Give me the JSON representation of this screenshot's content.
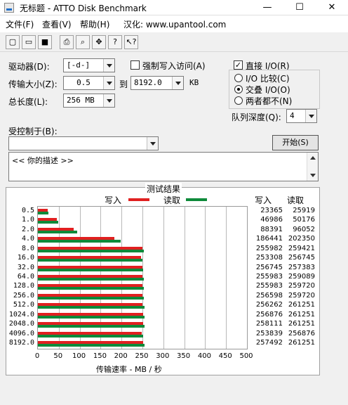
{
  "window": {
    "title": "无标题 - ATTO Disk Benchmark",
    "minimize": "—",
    "maximize": "☐",
    "close": "✕"
  },
  "menu": [
    "文件(F)",
    "查看(V)",
    "帮助(H)",
    "汉化: www.upantool.com"
  ],
  "toolbar": [
    {
      "icon": "new-icon",
      "glyph": "▢"
    },
    {
      "icon": "open-icon",
      "glyph": "▭"
    },
    {
      "icon": "save-icon",
      "glyph": "■"
    },
    {
      "icon": "print-icon",
      "glyph": "⎙"
    },
    {
      "icon": "print-preview-icon",
      "glyph": "⌕"
    },
    {
      "icon": "move-icon",
      "glyph": "✥"
    },
    {
      "icon": "help-icon",
      "glyph": "?"
    },
    {
      "icon": "context-help-icon",
      "glyph": "↖?"
    }
  ],
  "form": {
    "drive_label": "驱动器(D):",
    "drive_value": "[-d-]",
    "transfer_label": "传输大小(Z):",
    "transfer_from": "0.5",
    "to_label": "到",
    "transfer_to": "8192.0",
    "kb_label": "KB",
    "length_label": "总长度(L):",
    "length_value": "256 MB",
    "force_write_label": "强制写入访问(A)",
    "force_write_checked": false,
    "direct_io_label": "直接 I/O(R)",
    "direct_io_checked": true,
    "radio_io_compare": "I/O 比较(C)",
    "radio_overlap": "交叠 I/O(O)",
    "radio_neither": "两者都不(N)",
    "radio_selected": "overlap",
    "queue_label": "队列深度(Q):",
    "queue_value": "4",
    "controlled_label": "受控制于(B):",
    "controlled_value": "",
    "start_button": "开始(S)",
    "description": "<<  你的描述  >>"
  },
  "results": {
    "title": "测试结果",
    "write_legend": "写入",
    "read_legend": "读取",
    "write_header": "写入",
    "read_header": "读取",
    "x_axis_label": "传输速率 - MB / 秒"
  },
  "chart_data": {
    "type": "bar",
    "title": "测试结果",
    "xlabel": "传输速率 - MB / 秒",
    "xlim": [
      0,
      500
    ],
    "x_ticks": [
      0,
      50,
      100,
      150,
      200,
      250,
      300,
      350,
      400,
      450,
      500
    ],
    "categories": [
      "0.5",
      "1.0",
      "2.0",
      "4.0",
      "8.0",
      "16.0",
      "32.0",
      "64.0",
      "128.0",
      "256.0",
      "512.0",
      "1024.0",
      "2048.0",
      "4096.0",
      "8192.0"
    ],
    "series": [
      {
        "name": "写入",
        "color": "#e02020",
        "values_kb": [
          23365,
          46986,
          88391,
          186441,
          255982,
          253308,
          256745,
          255983,
          255983,
          256598,
          256262,
          256876,
          258111,
          253839,
          257492
        ]
      },
      {
        "name": "读取",
        "color": "#0e8a3a",
        "values_kb": [
          25919,
          50176,
          96052,
          202350,
          259421,
          256745,
          257383,
          259089,
          259720,
          259720,
          261251,
          261251,
          261251,
          256876,
          261251
        ]
      }
    ]
  }
}
